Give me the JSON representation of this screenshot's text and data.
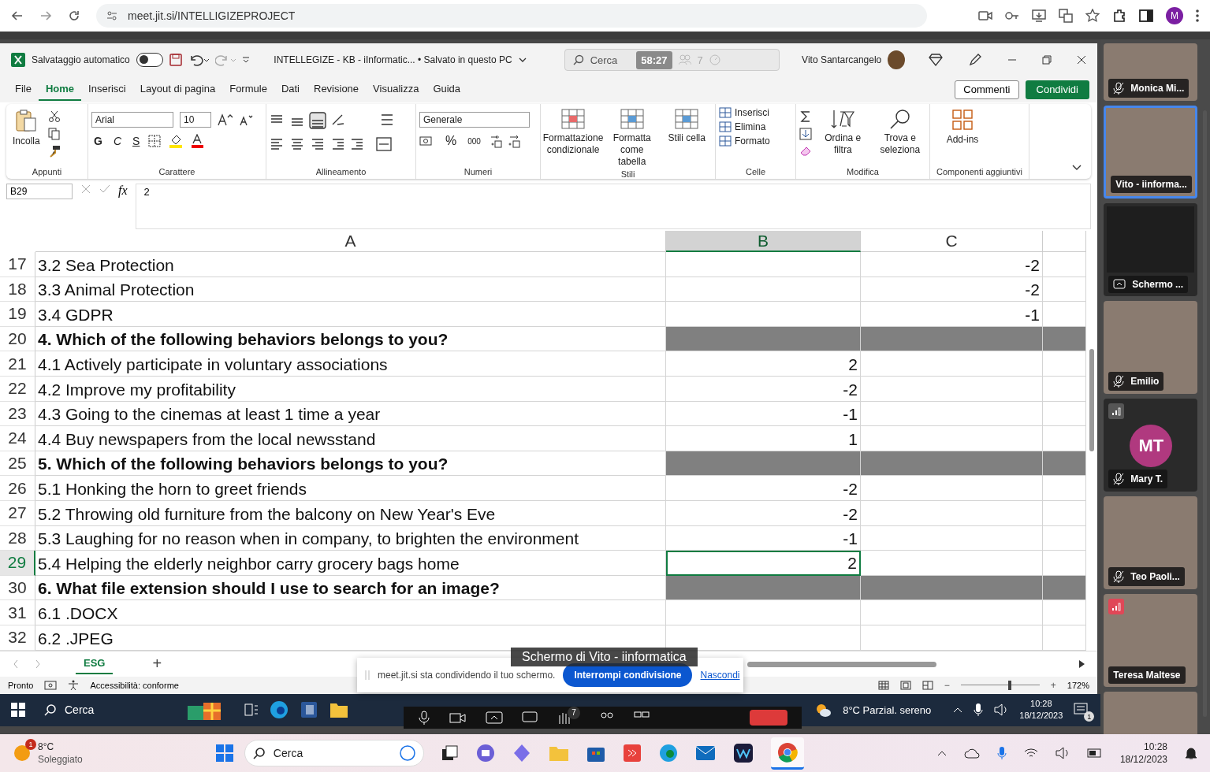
{
  "browser": {
    "url": "meet.jit.si/INTELLIGIZEPROJECT",
    "profile_initial": "M"
  },
  "excel": {
    "title_bar": {
      "autosave_label": "Salvataggio automatico",
      "autosave_on": false,
      "document_title": "INTELLEGIZE - KB - iInformatic... • Salvato in questo PC",
      "search_placeholder": "Cerca",
      "user_name": "Vito Santarcangelo"
    },
    "meeting_overlay": {
      "timer": "58:27",
      "participants_count": "7"
    },
    "menu_tabs": [
      {
        "label": "File",
        "selected": false
      },
      {
        "label": "Home",
        "selected": true
      },
      {
        "label": "Inserisci",
        "selected": false
      },
      {
        "label": "Layout di pagina",
        "selected": false
      },
      {
        "label": "Formule",
        "selected": false
      },
      {
        "label": "Dati",
        "selected": false
      },
      {
        "label": "Revisione",
        "selected": false
      },
      {
        "label": "Visualizza",
        "selected": false
      },
      {
        "label": "Guida",
        "selected": false
      }
    ],
    "comments_button": "Commenti",
    "share_button": "Condividi",
    "ribbon": {
      "clipboard": {
        "title": "Appunti",
        "paste": "Incolla"
      },
      "font": {
        "title": "Carattere",
        "family": "Arial",
        "size": "10",
        "bold": "G",
        "italic": "C",
        "underline": "S"
      },
      "alignment": {
        "title": "Allineamento"
      },
      "number": {
        "title": "Numeri",
        "format": "Generale",
        "percent": "%",
        "thousands": "000"
      },
      "styles": {
        "title": "Stili",
        "items": [
          "Formattazione condizionale",
          "Formatta come tabella",
          "Stili cella"
        ]
      },
      "cells": {
        "title": "Celle",
        "items": [
          "Inserisci",
          "Elimina",
          "Formato"
        ]
      },
      "editing": {
        "title": "Modifica",
        "items": [
          "Ordina e filtra",
          "Trova e seleziona"
        ]
      },
      "addins": {
        "title": "Componenti aggiuntivi",
        "button": "Add-ins"
      }
    },
    "formula_bar": {
      "name_box": "B29",
      "fx": "fx",
      "value": "2"
    },
    "columns": [
      {
        "label": "A",
        "selected": false
      },
      {
        "label": "B",
        "selected": true
      },
      {
        "label": "C",
        "selected": false
      }
    ],
    "rows": [
      {
        "number": "17",
        "kind": "item",
        "a": "3.2 Sea Protection",
        "c": "-2",
        "selected": false
      },
      {
        "number": "18",
        "kind": "item",
        "a": "3.3 Animal Protection",
        "c": "-2",
        "selected": false
      },
      {
        "number": "19",
        "kind": "item",
        "a": "3.4 GDPR",
        "c": "-1",
        "selected": false
      },
      {
        "number": "20",
        "kind": "question",
        "a": "4. Which of the following behaviors belongs to you?",
        "selected": false
      },
      {
        "number": "21",
        "kind": "item",
        "a": "4.1 Actively participate in voluntary associations",
        "b": "2",
        "selected": false
      },
      {
        "number": "22",
        "kind": "item",
        "a": "4.2 Improve my profitability",
        "b": "-2",
        "selected": false
      },
      {
        "number": "23",
        "kind": "item",
        "a": "4.3 Going to the cinemas at least 1 time a year",
        "b": "-1",
        "selected": false
      },
      {
        "number": "24",
        "kind": "item",
        "a": "4.4 Buy newspapers from the local newsstand",
        "b": "1",
        "selected": false
      },
      {
        "number": "25",
        "kind": "question",
        "a": "5. Which of the following behaviors belongs to you?",
        "selected": false
      },
      {
        "number": "26",
        "kind": "item",
        "a": "5.1 Honking the horn to greet friends",
        "b": "-2",
        "selected": false
      },
      {
        "number": "27",
        "kind": "item",
        "a": "5.2 Throwing old furniture from the balcony on New Year's Eve",
        "b": "-2",
        "selected": false
      },
      {
        "number": "28",
        "kind": "item",
        "a": "5.3 Laughing for no reason when in company, to brighten the environment",
        "b": "-1",
        "selected": false
      },
      {
        "number": "29",
        "kind": "item",
        "a": "5.4 Helping the elderly neighbor carry grocery bags home",
        "b": "2",
        "selected": true
      },
      {
        "number": "30",
        "kind": "question",
        "a": "6. What file extension should I use to search for an image?",
        "selected": false
      },
      {
        "number": "31",
        "kind": "item",
        "a": "6.1 .DOCX",
        "selected": false
      },
      {
        "number": "32",
        "kind": "item",
        "a": "6.2 .JPEG",
        "selected": false
      }
    ],
    "sheet_tabs": [
      {
        "label": "ESG",
        "selected": true
      }
    ],
    "add_sheet": "+",
    "status_bar": {
      "ready": "Pronto",
      "accessibility": "Accessibilità: conforme",
      "zoom_out": "−",
      "zoom_in": "+",
      "zoom": "172%",
      "level": 0.62
    }
  },
  "screen_label": "Schermo di Vito - iinformatica",
  "share_notice": {
    "text": "meet.jit.si sta condividendo il tuo schermo.",
    "stop_button": "Interrompi condivisione",
    "hide_link": "Nascondi"
  },
  "inner_taskbar": {
    "search": "Cerca",
    "weather": "8°C Parzial. sereno",
    "time": "10:28",
    "date": "18/12/2023",
    "notifications": "1",
    "toolbar_badge": "7"
  },
  "participants": [
    {
      "name": "Monica Mi...",
      "kind": "video",
      "muted": true,
      "selected": false
    },
    {
      "name": "Vito - iinforma...",
      "kind": "video",
      "muted": false,
      "selected": true
    },
    {
      "name": "Schermo ...",
      "kind": "screen",
      "muted": false,
      "selected": false
    },
    {
      "name": "Emilio",
      "kind": "video",
      "muted": true,
      "selected": false
    },
    {
      "name": "Mary T.",
      "kind": "avatar",
      "initials": "MT",
      "muted": true,
      "selected": false,
      "connection_indicator": true,
      "connection_poor": false
    },
    {
      "name": "Teo Paoli...",
      "kind": "video",
      "muted": true,
      "selected": false
    },
    {
      "name": "Teresa Maltese",
      "kind": "video",
      "muted": false,
      "selected": false,
      "connection_indicator": true,
      "connection_poor": true
    },
    {
      "kind": "video",
      "selected": false
    }
  ],
  "taskbar": {
    "temperature": "8°C",
    "weather": "Soleggiato",
    "weather_badge": "1",
    "search": "Cerca",
    "time": "10:28",
    "date": "18/12/2023"
  }
}
